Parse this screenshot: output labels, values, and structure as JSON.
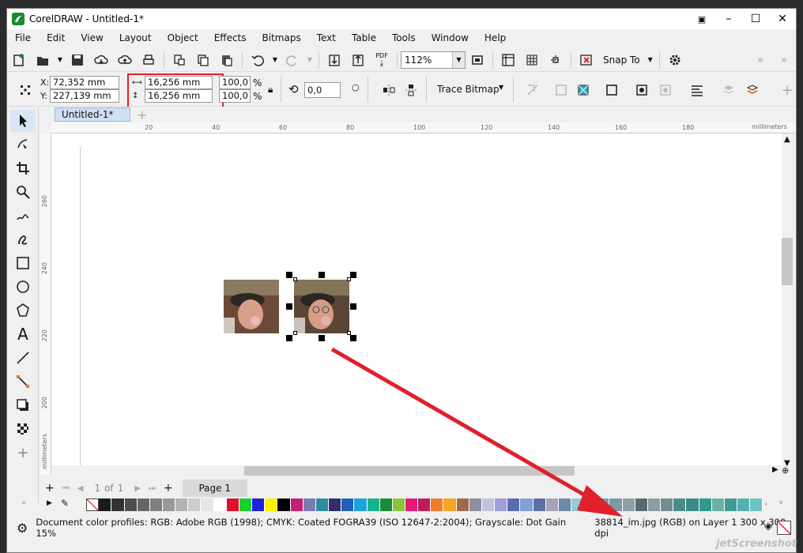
{
  "window": {
    "title": "CorelDRAW - Untitled-1*"
  },
  "menu": [
    "File",
    "Edit",
    "View",
    "Layout",
    "Object",
    "Effects",
    "Bitmaps",
    "Text",
    "Table",
    "Tools",
    "Window",
    "Help"
  ],
  "toolbar": {
    "zoom": "112%",
    "snap_label": "Snap To",
    "pdf_label": "PDF"
  },
  "property_bar": {
    "x_label": "X:",
    "x_value": "72,352 mm",
    "y_label": "Y:",
    "y_value": "227,139 mm",
    "width_value": "16,256 mm",
    "height_value": "16,256 mm",
    "scale_w": "100,0",
    "scale_h": "100,0",
    "pct": "%",
    "rotation": "0,0",
    "trace_label": "Trace Bitmap"
  },
  "doc_tab": {
    "label": "Untitled-1*"
  },
  "ruler": {
    "unit": "millimeters",
    "h_ticks": [
      "20",
      "40",
      "60",
      "80",
      "100",
      "120",
      "140",
      "160",
      "180"
    ],
    "v_ticks": [
      "260",
      "240",
      "220",
      "200"
    ],
    "v_unit": "millimeters"
  },
  "pagenav": {
    "page_counter": "1",
    "of_label": "of",
    "total": "1",
    "page_tab": "Page 1"
  },
  "status": {
    "profiles": "Document color profiles: RGB: Adobe RGB (1998); CMYK: Coated FOGRA39 (ISO 12647-2:2004); Grayscale: Dot Gain 15%",
    "selection": "38814_im.jpg (RGB) on Layer 1  300 x 300 dpi"
  },
  "palette": [
    "#ffffff",
    "#1a1a1a",
    "#333333",
    "#4d4d4d",
    "#666666",
    "#808080",
    "#999999",
    "#b3b3b3",
    "#cccccc",
    "#e6e6e6",
    "#ffffff",
    "#e0102a",
    "#18d12e",
    "#1f1fdc",
    "#ffee00",
    "#000000",
    "#c2207a",
    "#7b7bb0",
    "#2f8c9c",
    "#332c6e",
    "#1f5fb7",
    "#1ea0d8",
    "#16b38a",
    "#1d8c3a",
    "#8bc53f",
    "#e6187a",
    "#c01c5c",
    "#f27c2e",
    "#f5a623",
    "#a06a4a",
    "#8e8ea0",
    "#c2c2dd",
    "#9f9fd2",
    "#5a69b4",
    "#7fa1d3",
    "#5b6fa0",
    "#a4a4b8",
    "#6a8aa6",
    "#98c8d8",
    "#bcd3e4",
    "#5ea7b5",
    "#7a9aa5",
    "#91a0a6",
    "#5c6870",
    "#8a9ca4",
    "#6f8d8f",
    "#4f8a88",
    "#3b8a86",
    "#2f9a8a",
    "#6cb2a4",
    "#3e9a94",
    "#52b1b2",
    "#6fc2c6"
  ],
  "colors": {
    "accent": "#e0202a",
    "tab": "#cfe0f5"
  },
  "watermark": "jetScreenshot"
}
